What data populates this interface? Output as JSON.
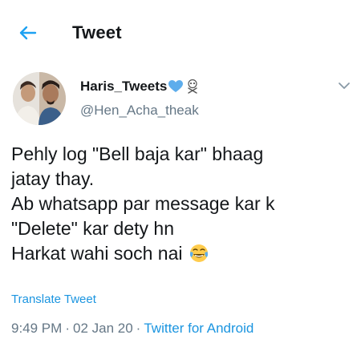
{
  "header": {
    "title": "Tweet",
    "back_icon": "arrow-left-icon",
    "accent_color": "#1da1f2"
  },
  "author": {
    "display_name": "Haris_Tweets",
    "handle": "@Hen_Acha_theak",
    "badges": [
      "blue-heart-icon",
      "skull-crossbones-icon"
    ],
    "avatar": "avatar-photo"
  },
  "tweet": {
    "lines": [
      "Pehly log \"Bell baja kar\" bhaag",
      "jatay thay.",
      "Ab whatsapp par message kar k",
      "\"Delete\" kar dety hn",
      "Harkat wahi soch nai"
    ],
    "trailing_emoji": "face-with-tears-of-joy-icon",
    "translate_label": "Translate Tweet"
  },
  "meta": {
    "time": "9:49 PM",
    "date": "02 Jan 20",
    "source": "Twitter for Android",
    "separator": "·"
  },
  "colors": {
    "text": "#14171a",
    "secondary": "#657786",
    "link": "#1b95e0"
  }
}
